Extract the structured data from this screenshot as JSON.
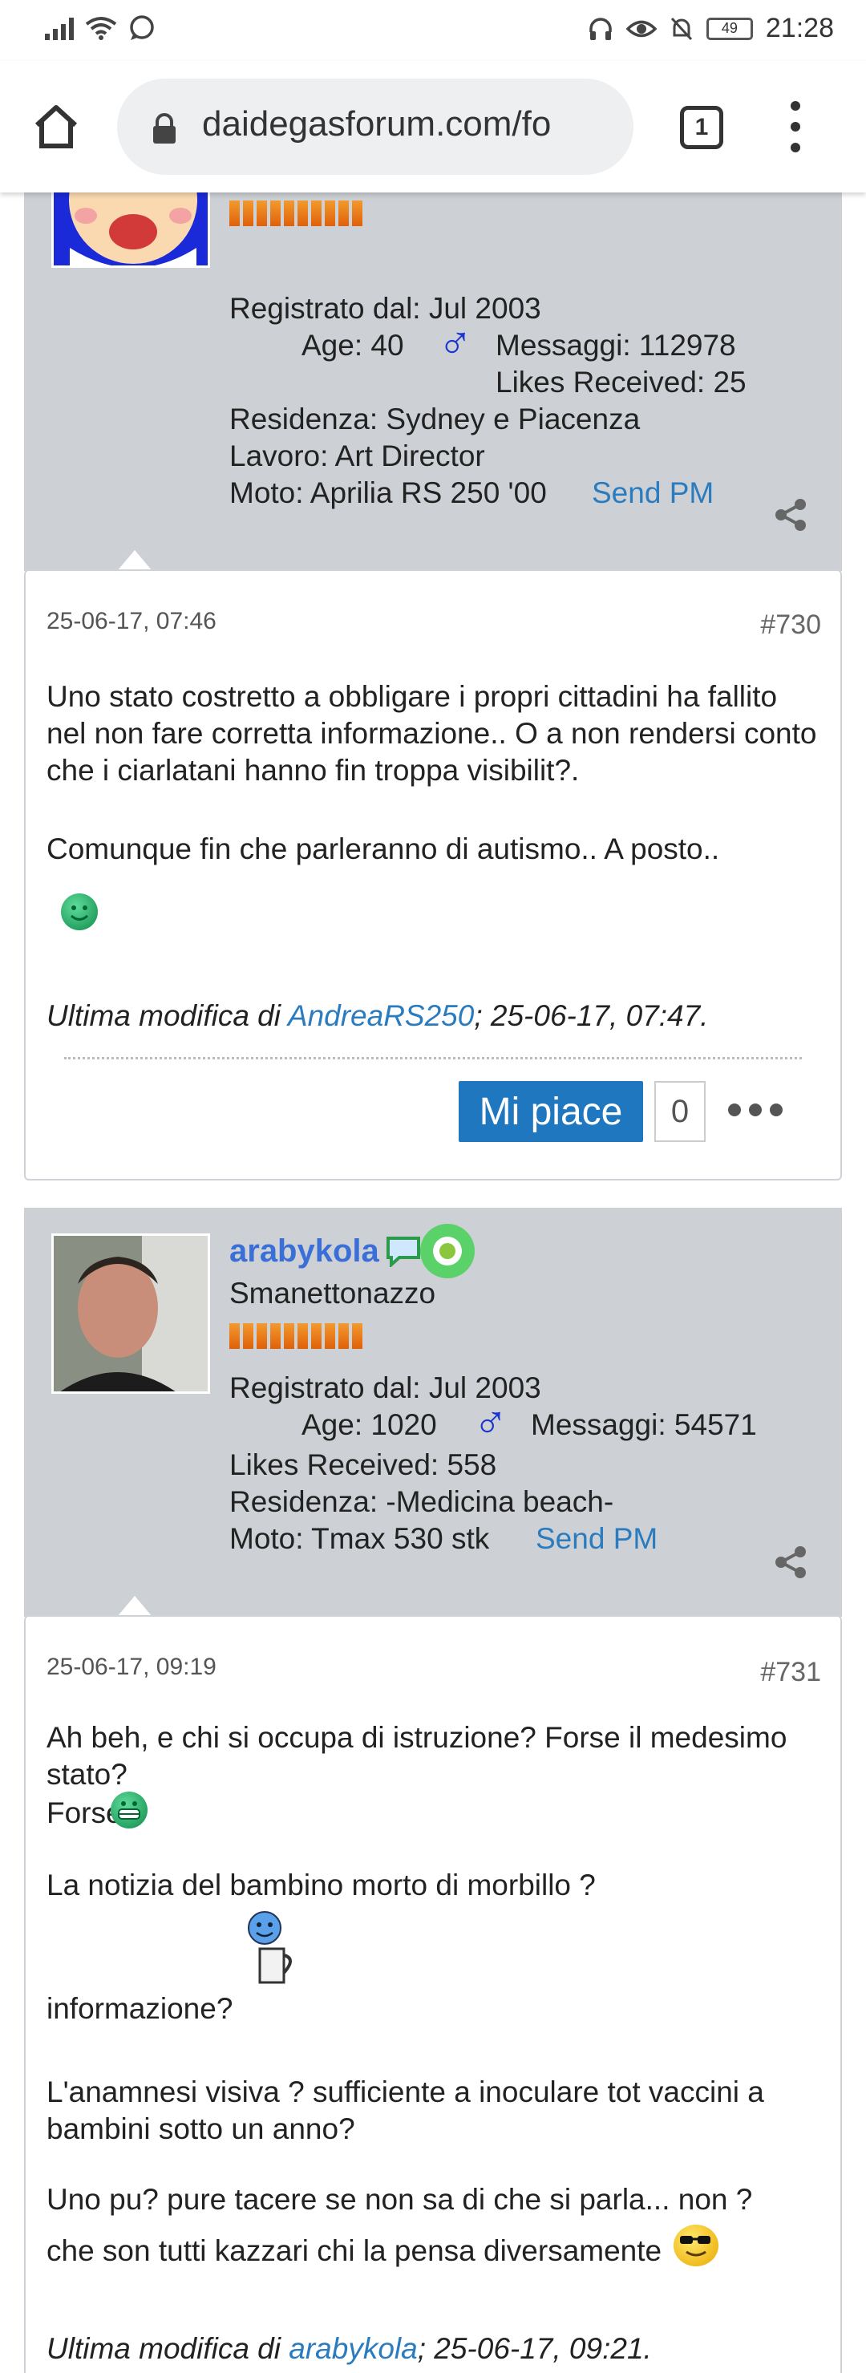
{
  "status_bar": {
    "time": "21:28",
    "battery": "49"
  },
  "browser": {
    "url": "daidegasforum.com/fo",
    "tab_count": "1"
  },
  "posts": [
    {
      "user": {
        "registered": "Registrato dal: Jul 2003",
        "age": "Age: 40",
        "male_symbol": "♂",
        "messages": "Messaggi: 112978",
        "likes": "Likes Received: 25",
        "residence": "Residenza: Sydney e Piacenza",
        "job": "Lavoro: Art Director",
        "moto": "Moto: Aprilia RS 250 '00",
        "send_pm": "Send PM"
      },
      "date": "25-06-17, 07:46",
      "number": "#730",
      "text1": "Uno stato costretto a obbligare i propri cittadini ha fallito nel non fare corretta informazione.. O a non rendersi conto che i ciarlatani hanno fin troppa visibilit?.",
      "text2": "Comunque fin che parleranno di autismo.. A posto..",
      "edited_prefix": "Ultima modifica di ",
      "edited_user": "AndreaRS250",
      "edited_suffix": "; 25-06-17, 07:47.",
      "like_label": "Mi piace",
      "like_count": "0"
    },
    {
      "user": {
        "username": "arabykola",
        "title": "Smanettonazzo",
        "registered": "Registrato dal: Jul 2003",
        "age": "Age: 1020",
        "male_symbol": "♂",
        "messages": "Messaggi: 54571",
        "likes": "Likes Received: 558",
        "residence": "Residenza: -Medicina beach-",
        "moto": "Moto: Tmax 530 stk",
        "send_pm": "Send PM"
      },
      "date": "25-06-17, 09:19",
      "number": "#731",
      "line1": "Ah beh, e chi si occupa di istruzione? Forse il medesimo stato?",
      "line2": "Forse",
      "line3": "La notizia del bambino morto di morbillo ?",
      "line4": "informazione?",
      "line5": "L'anamnesi visiva ? sufficiente a inoculare tot vaccini a bambini sotto un anno?",
      "line6a": "Uno pu? pure tacere se non sa di che si parla... non ?",
      "line6b": "che son tutti kazzari chi la pensa diversamente",
      "edited_prefix": "Ultima modifica di ",
      "edited_user": "arabykola",
      "edited_suffix": "; 25-06-17, 09:21."
    }
  ],
  "colors": {
    "userinfo_bg": "#cdd1d5",
    "link": "#2b7bbf",
    "like_button": "#1f77c0",
    "username": "#3a6fd8"
  }
}
